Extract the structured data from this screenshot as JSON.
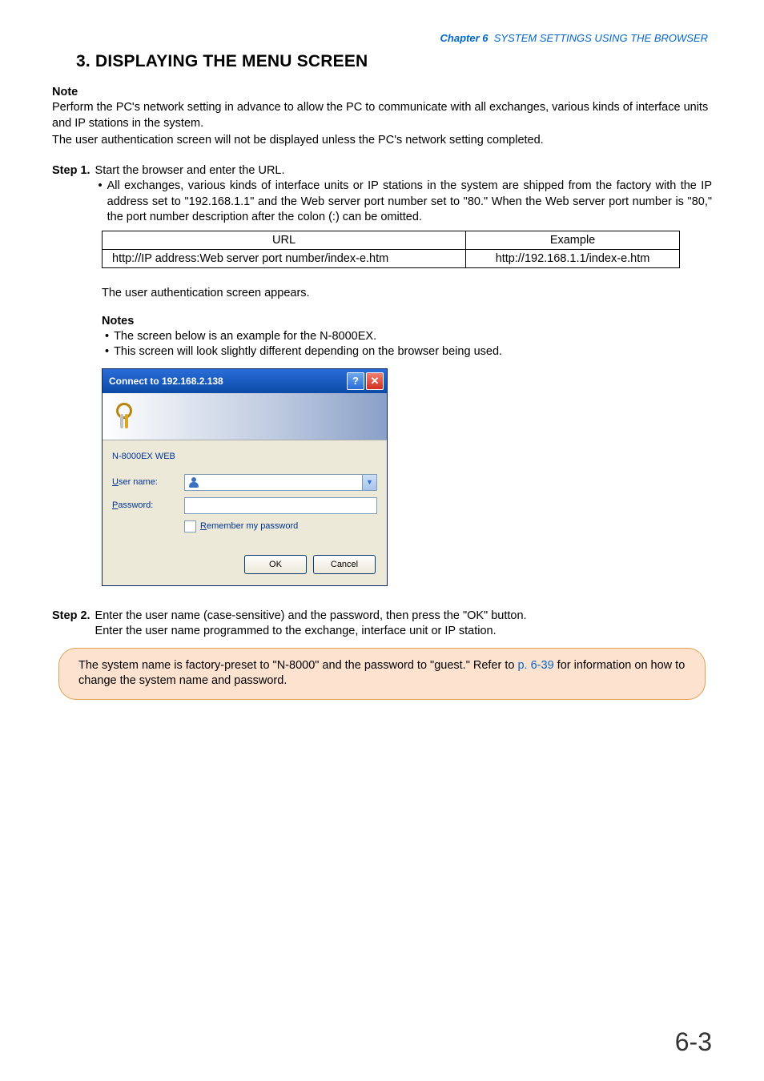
{
  "runningHeader": {
    "chapter": "Chapter 6",
    "title": "SYSTEM SETTINGS USING THE BROWSER"
  },
  "sectionTitle": "3. DISPLAYING THE MENU SCREEN",
  "noteHead": "Note",
  "noteBody1": "Perform the PC's network setting in advance to allow the PC to communicate with all exchanges, various kinds of interface units and IP stations in the system.",
  "noteBody2": "The user authentication screen will not be displayed unless the PC's network setting completed.",
  "step1": {
    "label": "Step 1.",
    "lead": "Start the browser and enter the URL.",
    "bullet": "All exchanges, various kinds of interface units or IP stations in the system are shipped from the factory with the IP address set to \"192.168.1.1\" and the Web server port number set to \"80.\" When the Web server port number is \"80,\" the port number description after the colon (:) can be omitted."
  },
  "urlTable": {
    "headers": [
      "URL",
      "Example"
    ],
    "row": [
      "http://IP address:Web server port number/index-e.htm",
      "http://192.168.1.1/index-e.htm"
    ]
  },
  "authAppears": "The user authentication screen appears.",
  "notesHead": "Notes",
  "notesBullet1": "The screen below is an example for the N-8000EX.",
  "notesBullet2": "This screen will look slightly different depending on the browser being used.",
  "dialog": {
    "title": "Connect to 192.168.2.138",
    "realm": "N-8000EX WEB",
    "userLabelPrefix": "U",
    "userLabelRest": "ser name:",
    "passLabelPrefix": "P",
    "passLabelRest": "assword:",
    "rememberPrefix": "R",
    "rememberRest": "emember my password",
    "ok": "OK",
    "cancel": "Cancel"
  },
  "step2": {
    "label": "Step 2.",
    "line1": "Enter the user name (case-sensitive) and the password, then press the \"OK\" button.",
    "line2": "Enter the user name programmed to the exchange, interface unit or IP station."
  },
  "callout": {
    "textA": "The system name is factory-preset to \"N-8000\" and the password to \"guest.\" Refer to ",
    "link": "p. 6-39",
    "textB": " for information on how to change the system name and password."
  },
  "pageNumber": "6-3"
}
